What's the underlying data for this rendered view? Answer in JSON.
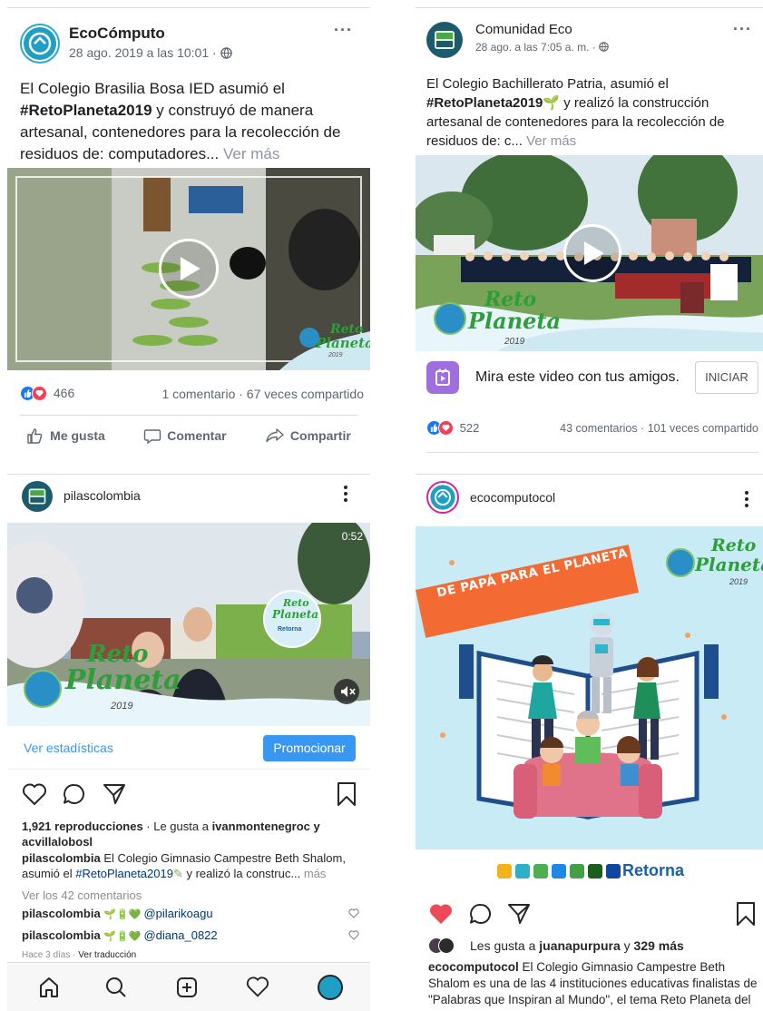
{
  "post1": {
    "account": "EcoCómputo",
    "meta": "28 ago. 2019 a las 10:01 · ",
    "text_before": "El Colegio Brasilia Bosa IED asumió el ",
    "hashtag": "#RetoPlaneta2019",
    "text_after": " y construyó de manera artesanal, contenedores para la recolección de residuos de: computadores... ",
    "see_more": "Ver más",
    "reaction_count": "466",
    "engagement": "1 comentario · 67 veces compartido",
    "like_label": "Me gusta",
    "comment_label": "Comentar",
    "share_label": "Compartir"
  },
  "post2": {
    "account": "Comunidad Eco",
    "meta": "28 ago. a las 7:05 a. m. · ",
    "text_before": "El Colegio Bachillerato Patria, asumió el ",
    "hashtag": "#RetoPlaneta2019",
    "text_after": " y realizó la construcción artesanal de contenedores para la recolección de residuos de: c... ",
    "see_more": "Ver más",
    "watch_prompt": "Mira este video con tus amigos.",
    "start_button": "INICIAR",
    "reaction_count": "522",
    "engagement": "43 comentarios · 101 veces compartido"
  },
  "post3": {
    "account": "pilascolombia",
    "video_time": "0:52",
    "stats_link": "Ver estadísticas",
    "promote_button": "Promocionar",
    "views": "1,921 reproducciones",
    "liked_by_prefix": " · Le gusta a ",
    "liked_by": "ivanmontenegroc y acvillalobosl",
    "caption_user": "pilascolombia",
    "caption_before": " El Colegio Gimnasio Campestre Beth Shalom, asumió el ",
    "caption_hashtag": "#RetoPlaneta2019",
    "caption_after": " y realizó la construc... ",
    "caption_more": "más",
    "view_comments": "Ver los 42 comentarios",
    "comments": [
      {
        "user": "pilascolombia",
        "mention": "@pilarikoagu"
      },
      {
        "user": "pilascolombia",
        "mention": "@diana_0822"
      }
    ],
    "time_ago": "Hace 3 días",
    "translate": "Ver traducción"
  },
  "post4": {
    "account": "ecocomputocol",
    "banner_text": "DE PAPÁ PARA EL PLANETA",
    "sponsor_name": "Retorna",
    "likes_prefix": "Les gusta a ",
    "likes_user": "juanapurpura",
    "likes_middle": " y ",
    "likes_more": "329 más",
    "caption_user": "ecocomputocol",
    "caption": " El Colegio Gimnasio Campestre Beth Shalom es una de las 4 instituciones educativas finalistas de \"Palabras que Inspiran al Mundo\", el tema Reto Planeta del año. Ven, dile a tus tidi"
  },
  "logo": {
    "reto": "Reto",
    "planeta": "Planeta",
    "year": "2019"
  },
  "colors": {
    "fb_blue": "#1877f2",
    "like_red": "#ed4956",
    "ig_blue": "#3897f0",
    "reto_green": "#2e9e3a"
  }
}
